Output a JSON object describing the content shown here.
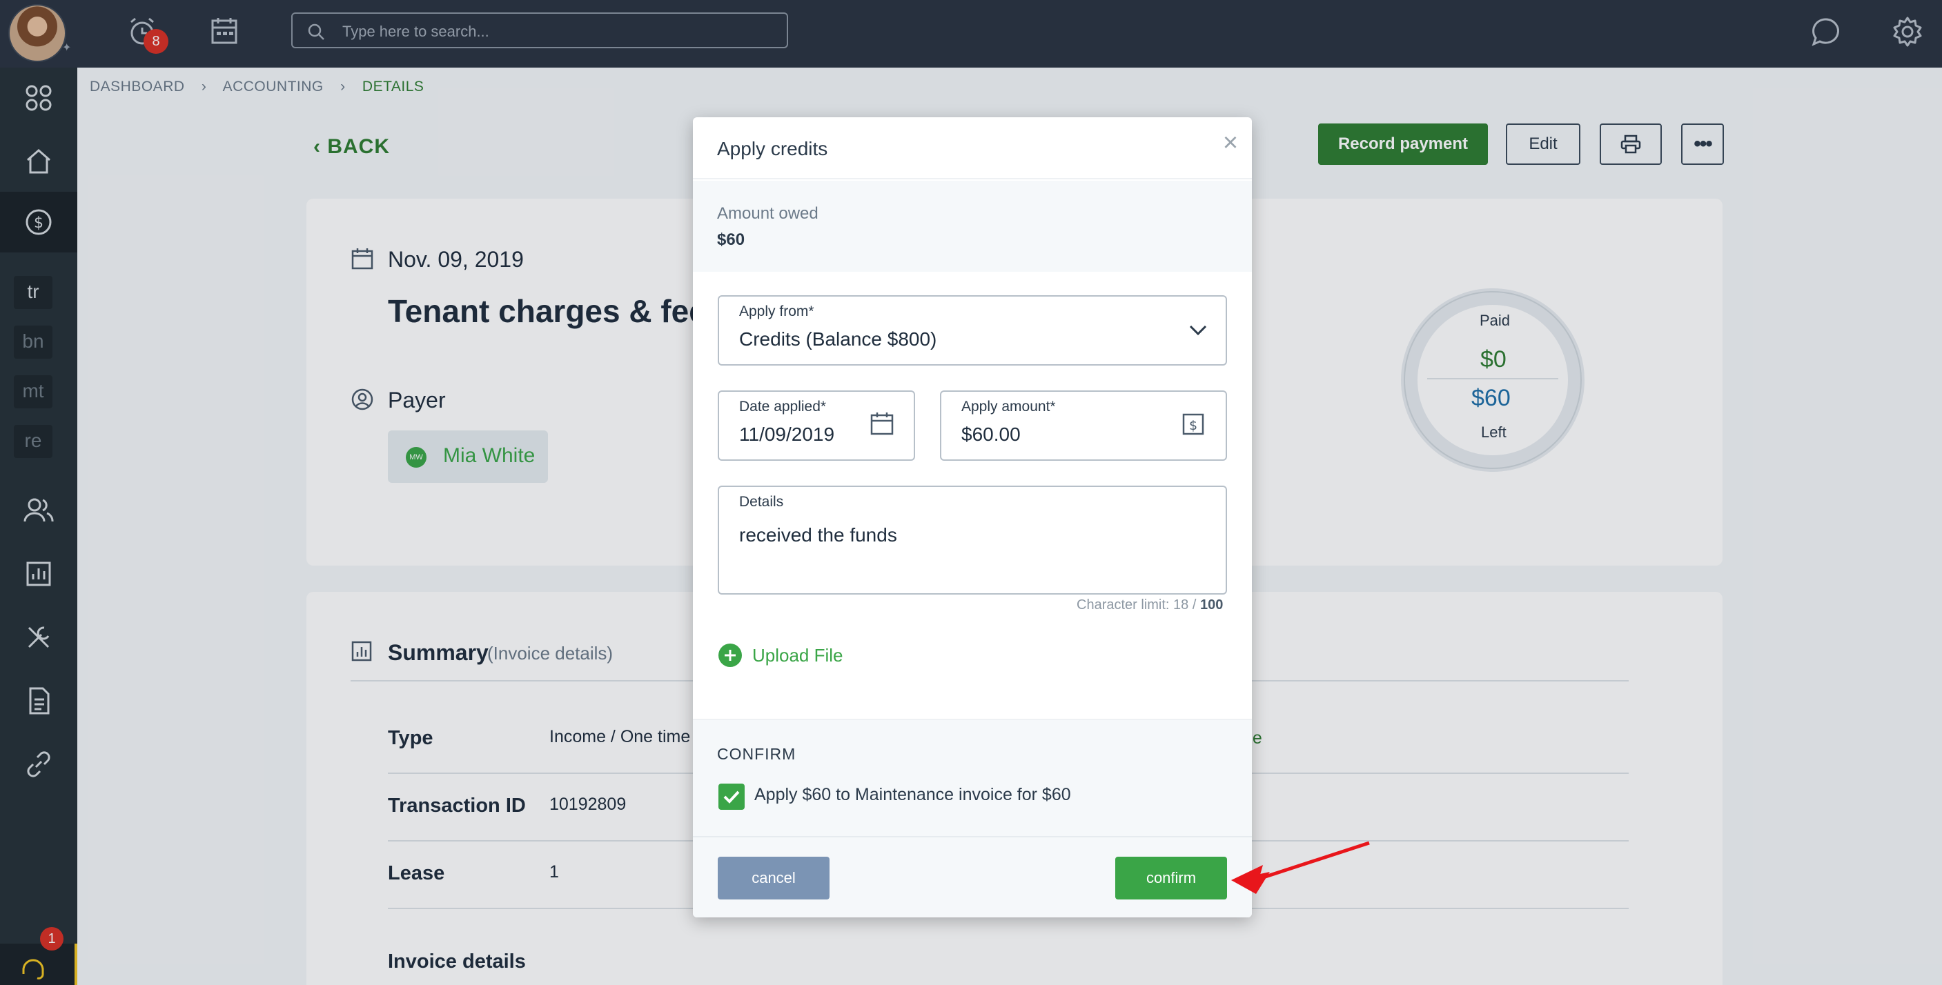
{
  "topbar": {
    "search_placeholder": "Type here to search...",
    "alerts_count": "8"
  },
  "sidebar": {
    "chips": [
      "tr",
      "bn",
      "mt",
      "re"
    ],
    "support_count": "1"
  },
  "page": {
    "breadcrumb": [
      "DASHBOARD",
      "ACCOUNTING",
      "DETAILS"
    ],
    "back_label": "BACK",
    "record_payment": "Record payment",
    "edit": "Edit",
    "date": "Nov. 09, 2019",
    "title": "Tenant charges & fees",
    "payer_label": "Payer",
    "payer_initials": "MW",
    "payer_name": "Mia White",
    "donut": {
      "paid_label": "Paid",
      "paid": "$0",
      "left": "$60",
      "left_label": "Left"
    },
    "summary_title": "Summary",
    "summary_sub": "(Invoice details)",
    "rows": [
      {
        "label": "Type",
        "value": "Income / One time"
      },
      {
        "label": "Transaction ID",
        "value": "10192809"
      },
      {
        "label": "Lease",
        "value": "1"
      }
    ],
    "invoice_details": "Invoice details",
    "right_link": "me"
  },
  "modal": {
    "title": "Apply credits",
    "amount_owed_label": "Amount owed",
    "amount_owed": "$60",
    "apply_from_label": "Apply from*",
    "apply_from_value": "Credits (Balance $800)",
    "date_label": "Date applied*",
    "date_value": "11/09/2019",
    "amount_label": "Apply amount*",
    "amount_value": "$60.00",
    "details_label": "Details",
    "details_value": "received the funds",
    "char_limit_prefix": "Character limit: 18 /",
    "char_limit_max": "100",
    "upload_label": "Upload File",
    "confirm_heading": "CONFIRM",
    "confirm_text": "Apply $60 to Maintenance invoice for $60",
    "cancel": "cancel",
    "confirm": "confirm"
  },
  "colors": {
    "brand_green": "#2e7d32",
    "accent_green": "#3aa547",
    "cancel_blue": "#7b94b4",
    "topbar": "#2b3441",
    "annotation_arrow": "#e8161b"
  }
}
